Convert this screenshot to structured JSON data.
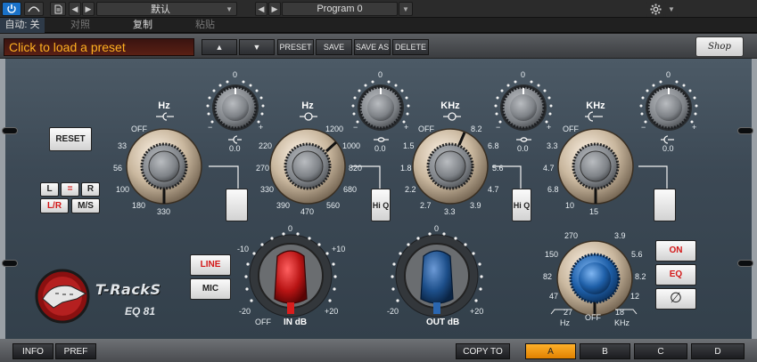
{
  "host": {
    "power_icon": "power-icon",
    "auto_icon": "automation-icon",
    "doc_icon": "document-icon",
    "preset_name": "默认",
    "program": "Program 0",
    "auto_label": "自动: 关",
    "compare_label": "对照",
    "copy_label": "复制",
    "paste_label": "粘贴",
    "gear_icon": "gear-icon"
  },
  "plugin": {
    "preset_field": "Click to load a preset",
    "toolbar": {
      "up": "▲",
      "down": "▼",
      "preset": "PRESET",
      "save": "SAVE",
      "save_as": "SAVE AS",
      "delete": "DELETE"
    },
    "shop": "Shop",
    "reset": "RESET",
    "mode": {
      "l": "L",
      "eq": "=",
      "r": "R",
      "lr": "L/R",
      "ms": "M/S"
    },
    "bands": [
      {
        "title": "Hz",
        "freq_ticks": [
          "OFF",
          "33",
          "56",
          "100",
          "180",
          "330"
        ],
        "gain_ticks": {
          "top": "0",
          "minus": "−",
          "plus": "+",
          "value": "0.0"
        }
      },
      {
        "title": "Hz",
        "freq_ticks": [
          "1200",
          "220",
          "1000",
          "270",
          "820",
          "330",
          "680",
          "390",
          "470",
          "560"
        ],
        "gain_ticks": {
          "top": "0",
          "minus": "−",
          "plus": "+",
          "value": "0.0"
        },
        "hiq": "Hi Q"
      },
      {
        "title": "KHz",
        "freq_ticks": [
          "OFF",
          "8.2",
          "1.5",
          "6.8",
          "1.8",
          "5.6",
          "2.2",
          "4.7",
          "2.7",
          "3.3",
          "3.9"
        ],
        "gain_ticks": {
          "top": "0",
          "minus": "−",
          "plus": "+",
          "value": "0.0"
        },
        "hiq": "Hi Q"
      },
      {
        "title": "KHz",
        "freq_ticks": [
          "OFF",
          "3.3",
          "4.7",
          "6.8",
          "10",
          "15"
        ],
        "gain_ticks": {
          "top": "0",
          "minus": "−",
          "plus": "+",
          "value": "0.0"
        }
      }
    ],
    "line": "LINE",
    "mic": "MIC",
    "brand": "T-RackS",
    "model": "EQ 81",
    "in_db": {
      "label": "IN dB",
      "ticks": [
        "0",
        "-10",
        "+10",
        "-20",
        "+20",
        "OFF"
      ]
    },
    "out_db": {
      "label": "OUT dB",
      "ticks": [
        "0",
        "-20",
        "+20"
      ]
    },
    "hpf": {
      "ticks": [
        "270",
        "3.9",
        "150",
        "5.6",
        "82",
        "8.2",
        "47",
        "12",
        "27",
        "OFF",
        "18"
      ],
      "low_unit": "Hz",
      "high_unit": "KHz"
    },
    "on": "ON",
    "eq": "EQ",
    "phase": "∅",
    "bottom": {
      "info": "INFO",
      "pref": "PREF",
      "copy_to": "COPY TO",
      "a": "A",
      "b": "B",
      "c": "C",
      "d": "D"
    }
  },
  "colors": {
    "accent": "#ffb020",
    "selected_slot": "#f39a10",
    "input_knob": "#b81414",
    "output_knob": "#1d4f8a",
    "hpf_knob": "#1e5fa8"
  }
}
